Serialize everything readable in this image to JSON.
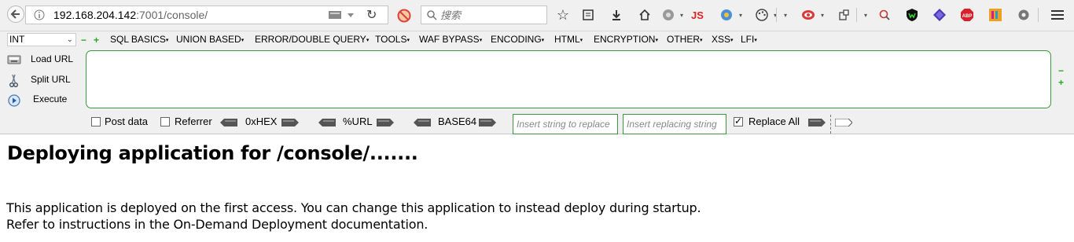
{
  "browser": {
    "url_host": "192.168.204.142",
    "url_rest": ":7001/console/",
    "search_placeholder": "搜索",
    "icons": [
      "back-icon",
      "site-info-icon",
      "dropdown-icon",
      "reload-icon",
      "blocked-icon",
      "search-icon",
      "bookmark-star-icon",
      "reading-list-icon",
      "download-icon",
      "home-icon",
      "globe-icon",
      "js-icon",
      "translate-icon",
      "palette-icon",
      "eye-icon",
      "screenshot-icon",
      "inspect-icon",
      "shield-icon",
      "cube-icon",
      "adblock-icon",
      "color-icon",
      "gear-icon",
      "menu-icon"
    ],
    "js_label": "JS",
    "abp_label": "ABP"
  },
  "hackbar": {
    "select_value": "INT",
    "menu": [
      "SQL BASICS",
      "UNION BASED",
      "ERROR/DOUBLE QUERY",
      "TOOLS",
      "WAF BYPASS",
      "ENCODING",
      "HTML",
      "ENCRYPTION",
      "OTHER",
      "XSS",
      "LFI"
    ],
    "actions": {
      "load": "Load URL",
      "split": "Split URL",
      "execute": "Execute"
    },
    "url_value": "",
    "post_data": "Post data",
    "referrer": "Referrer",
    "hex": "0xHEX",
    "urlenc": "%URL",
    "base64": "BASE64",
    "find_placeholder": "Insert string to replace",
    "replace_placeholder": "Insert replacing string",
    "replace_all": "Replace All",
    "replace_all_checked": true,
    "accent_color": "#3a9a3a"
  },
  "content": {
    "heading": "Deploying application for /console/.......",
    "line1": "This application is deployed on the first access. You can change this application to instead deploy during startup.",
    "line2": "Refer to instructions in the On-Demand Deployment documentation."
  }
}
